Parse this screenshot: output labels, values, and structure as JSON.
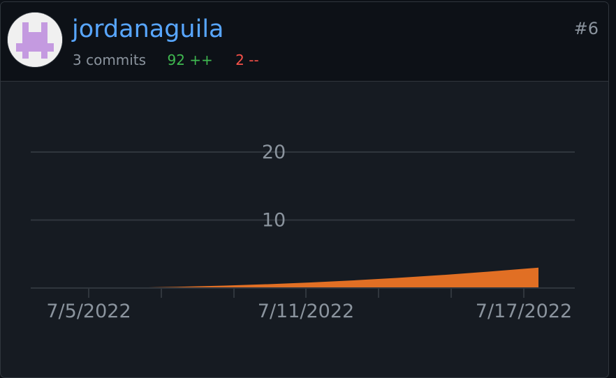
{
  "contributor": {
    "username": "jordanaguila",
    "commits": "3 commits",
    "additions": "92 ++",
    "deletions": "2 --",
    "rank": "#6",
    "avatar_color": "#c49ae0"
  },
  "chart_data": {
    "type": "area",
    "x": [
      "7/3/2022",
      "7/17/2022"
    ],
    "values": [
      0,
      3
    ],
    "xticks": [
      "7/5/2022",
      "7/11/2022",
      "7/17/2022"
    ],
    "yticks": [
      "10",
      "20"
    ],
    "ylim": [
      0,
      20
    ],
    "fill_color": "#e16f24",
    "grid": true
  }
}
